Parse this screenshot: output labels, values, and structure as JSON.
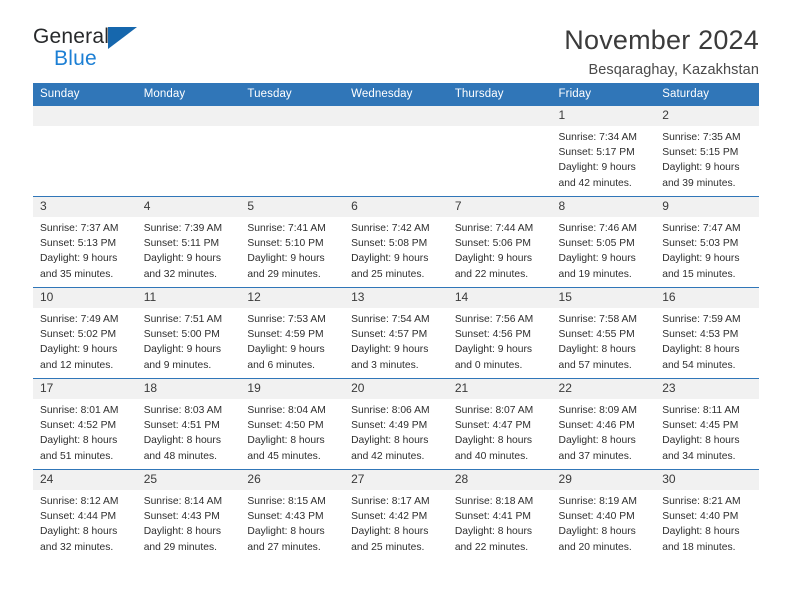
{
  "brand": {
    "name_top": "General",
    "name_bottom": "Blue",
    "triangle_color": "#1667ad",
    "blue_color": "#1c7fd4"
  },
  "header": {
    "title": "November 2024",
    "subtitle": "Besqaraghay, Kazakhstan"
  },
  "theme": {
    "header_blue": "#3076b8",
    "daynum_bg": "#f1f1f1"
  },
  "calendar": {
    "weekdays": [
      "Sunday",
      "Monday",
      "Tuesday",
      "Wednesday",
      "Thursday",
      "Friday",
      "Saturday"
    ],
    "weeks": [
      [
        {
          "day": "",
          "lines": []
        },
        {
          "day": "",
          "lines": []
        },
        {
          "day": "",
          "lines": []
        },
        {
          "day": "",
          "lines": []
        },
        {
          "day": "",
          "lines": []
        },
        {
          "day": "1",
          "lines": [
            "Sunrise: 7:34 AM",
            "Sunset: 5:17 PM",
            "Daylight: 9 hours",
            "and 42 minutes."
          ]
        },
        {
          "day": "2",
          "lines": [
            "Sunrise: 7:35 AM",
            "Sunset: 5:15 PM",
            "Daylight: 9 hours",
            "and 39 minutes."
          ]
        }
      ],
      [
        {
          "day": "3",
          "lines": [
            "Sunrise: 7:37 AM",
            "Sunset: 5:13 PM",
            "Daylight: 9 hours",
            "and 35 minutes."
          ]
        },
        {
          "day": "4",
          "lines": [
            "Sunrise: 7:39 AM",
            "Sunset: 5:11 PM",
            "Daylight: 9 hours",
            "and 32 minutes."
          ]
        },
        {
          "day": "5",
          "lines": [
            "Sunrise: 7:41 AM",
            "Sunset: 5:10 PM",
            "Daylight: 9 hours",
            "and 29 minutes."
          ]
        },
        {
          "day": "6",
          "lines": [
            "Sunrise: 7:42 AM",
            "Sunset: 5:08 PM",
            "Daylight: 9 hours",
            "and 25 minutes."
          ]
        },
        {
          "day": "7",
          "lines": [
            "Sunrise: 7:44 AM",
            "Sunset: 5:06 PM",
            "Daylight: 9 hours",
            "and 22 minutes."
          ]
        },
        {
          "day": "8",
          "lines": [
            "Sunrise: 7:46 AM",
            "Sunset: 5:05 PM",
            "Daylight: 9 hours",
            "and 19 minutes."
          ]
        },
        {
          "day": "9",
          "lines": [
            "Sunrise: 7:47 AM",
            "Sunset: 5:03 PM",
            "Daylight: 9 hours",
            "and 15 minutes."
          ]
        }
      ],
      [
        {
          "day": "10",
          "lines": [
            "Sunrise: 7:49 AM",
            "Sunset: 5:02 PM",
            "Daylight: 9 hours",
            "and 12 minutes."
          ]
        },
        {
          "day": "11",
          "lines": [
            "Sunrise: 7:51 AM",
            "Sunset: 5:00 PM",
            "Daylight: 9 hours",
            "and 9 minutes."
          ]
        },
        {
          "day": "12",
          "lines": [
            "Sunrise: 7:53 AM",
            "Sunset: 4:59 PM",
            "Daylight: 9 hours",
            "and 6 minutes."
          ]
        },
        {
          "day": "13",
          "lines": [
            "Sunrise: 7:54 AM",
            "Sunset: 4:57 PM",
            "Daylight: 9 hours",
            "and 3 minutes."
          ]
        },
        {
          "day": "14",
          "lines": [
            "Sunrise: 7:56 AM",
            "Sunset: 4:56 PM",
            "Daylight: 9 hours",
            "and 0 minutes."
          ]
        },
        {
          "day": "15",
          "lines": [
            "Sunrise: 7:58 AM",
            "Sunset: 4:55 PM",
            "Daylight: 8 hours",
            "and 57 minutes."
          ]
        },
        {
          "day": "16",
          "lines": [
            "Sunrise: 7:59 AM",
            "Sunset: 4:53 PM",
            "Daylight: 8 hours",
            "and 54 minutes."
          ]
        }
      ],
      [
        {
          "day": "17",
          "lines": [
            "Sunrise: 8:01 AM",
            "Sunset: 4:52 PM",
            "Daylight: 8 hours",
            "and 51 minutes."
          ]
        },
        {
          "day": "18",
          "lines": [
            "Sunrise: 8:03 AM",
            "Sunset: 4:51 PM",
            "Daylight: 8 hours",
            "and 48 minutes."
          ]
        },
        {
          "day": "19",
          "lines": [
            "Sunrise: 8:04 AM",
            "Sunset: 4:50 PM",
            "Daylight: 8 hours",
            "and 45 minutes."
          ]
        },
        {
          "day": "20",
          "lines": [
            "Sunrise: 8:06 AM",
            "Sunset: 4:49 PM",
            "Daylight: 8 hours",
            "and 42 minutes."
          ]
        },
        {
          "day": "21",
          "lines": [
            "Sunrise: 8:07 AM",
            "Sunset: 4:47 PM",
            "Daylight: 8 hours",
            "and 40 minutes."
          ]
        },
        {
          "day": "22",
          "lines": [
            "Sunrise: 8:09 AM",
            "Sunset: 4:46 PM",
            "Daylight: 8 hours",
            "and 37 minutes."
          ]
        },
        {
          "day": "23",
          "lines": [
            "Sunrise: 8:11 AM",
            "Sunset: 4:45 PM",
            "Daylight: 8 hours",
            "and 34 minutes."
          ]
        }
      ],
      [
        {
          "day": "24",
          "lines": [
            "Sunrise: 8:12 AM",
            "Sunset: 4:44 PM",
            "Daylight: 8 hours",
            "and 32 minutes."
          ]
        },
        {
          "day": "25",
          "lines": [
            "Sunrise: 8:14 AM",
            "Sunset: 4:43 PM",
            "Daylight: 8 hours",
            "and 29 minutes."
          ]
        },
        {
          "day": "26",
          "lines": [
            "Sunrise: 8:15 AM",
            "Sunset: 4:43 PM",
            "Daylight: 8 hours",
            "and 27 minutes."
          ]
        },
        {
          "day": "27",
          "lines": [
            "Sunrise: 8:17 AM",
            "Sunset: 4:42 PM",
            "Daylight: 8 hours",
            "and 25 minutes."
          ]
        },
        {
          "day": "28",
          "lines": [
            "Sunrise: 8:18 AM",
            "Sunset: 4:41 PM",
            "Daylight: 8 hours",
            "and 22 minutes."
          ]
        },
        {
          "day": "29",
          "lines": [
            "Sunrise: 8:19 AM",
            "Sunset: 4:40 PM",
            "Daylight: 8 hours",
            "and 20 minutes."
          ]
        },
        {
          "day": "30",
          "lines": [
            "Sunrise: 8:21 AM",
            "Sunset: 4:40 PM",
            "Daylight: 8 hours",
            "and 18 minutes."
          ]
        }
      ]
    ]
  }
}
